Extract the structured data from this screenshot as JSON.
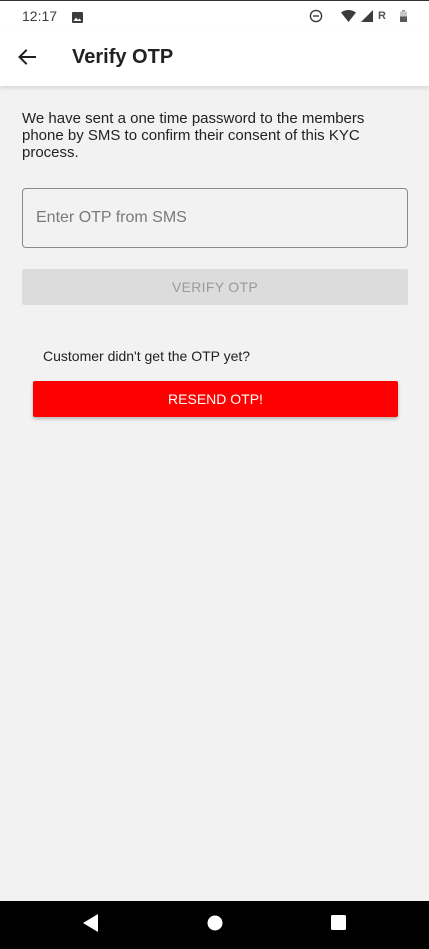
{
  "status_bar": {
    "time": "12:17",
    "network_label": "R"
  },
  "app_bar": {
    "title": "Verify OTP"
  },
  "main": {
    "intro_text": "We have sent a one time password to the members phone by SMS to confirm their consent of this KYC process.",
    "otp_field": {
      "placeholder": "Enter OTP from SMS",
      "value": ""
    },
    "verify_button_label": "VERIFY OTP",
    "resend_prompt": "Customer didn't get the OTP yet?",
    "resend_button_label": "RESEND OTP!"
  },
  "icons": {
    "status_left": "image-icon",
    "status_right": [
      "do-not-disturb-icon",
      "wifi-icon",
      "signal-icon",
      "battery-icon"
    ],
    "app_bar": "back-arrow-icon",
    "nav": [
      "nav-back-icon",
      "nav-home-icon",
      "nav-recents-icon"
    ]
  },
  "colors": {
    "accent": "#ff0000",
    "background": "#f2f2f2",
    "disabled_button": "#dcdcdc",
    "disabled_text": "#9a9a9a"
  }
}
